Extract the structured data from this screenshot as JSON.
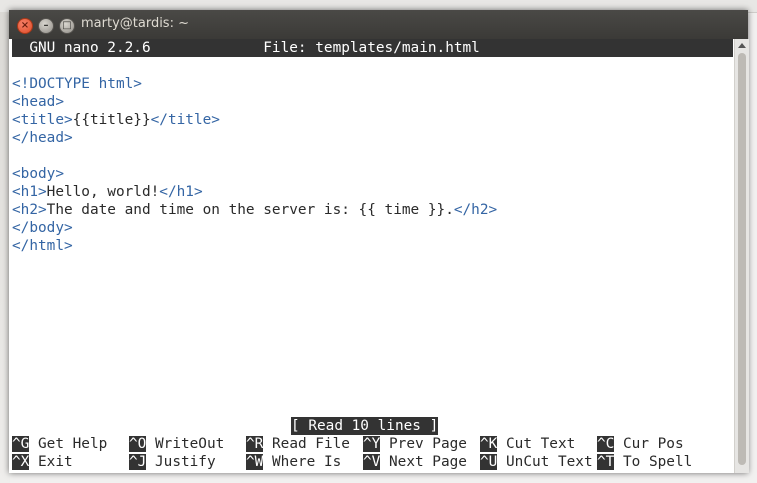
{
  "window": {
    "title": "marty@tardis: ~"
  },
  "nano": {
    "header": "  GNU nano 2.2.6             File: templates/main.html",
    "status": "[ Read 10 lines ]",
    "lines": [
      "",
      "<!DOCTYPE html>",
      "<head>",
      "<title>{{title}}</title>",
      "</head>",
      "",
      "<body>",
      "<h1>Hello, world!</h1>",
      "<h2>The date and time on the server is: {{ time }}.</h2>",
      "</body>",
      "</html>"
    ],
    "shortcuts": [
      [
        {
          "key": "^G",
          "label": " Get Help  "
        },
        {
          "key": "^O",
          "label": " WriteOut  "
        },
        {
          "key": "^R",
          "label": " Read File "
        },
        {
          "key": "^Y",
          "label": " Prev Page "
        },
        {
          "key": "^K",
          "label": " Cut Text  "
        },
        {
          "key": "^C",
          "label": " Cur Pos"
        }
      ],
      [
        {
          "key": "^X",
          "label": " Exit      "
        },
        {
          "key": "^J",
          "label": " Justify   "
        },
        {
          "key": "^W",
          "label": " Where Is  "
        },
        {
          "key": "^V",
          "label": " Next Page "
        },
        {
          "key": "^U",
          "label": " UnCut Text"
        },
        {
          "key": "^T",
          "label": " To Spell"
        }
      ]
    ]
  },
  "colors": {
    "tag": "#3465a4",
    "text": "#2a2a2a",
    "inverse_bg": "#333333",
    "titlebar": "#3c3b37"
  }
}
